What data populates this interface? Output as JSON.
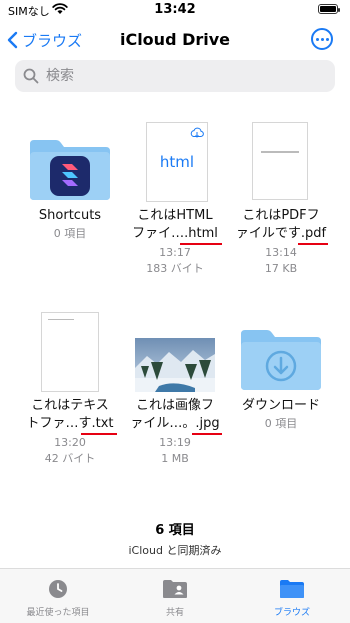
{
  "status_bar": {
    "carrier": "SIMなし",
    "time": "13:42"
  },
  "nav": {
    "back_label": "ブラウズ",
    "title": "iCloud Drive"
  },
  "search": {
    "placeholder": "検索"
  },
  "items": [
    {
      "name_line1": "Shortcuts",
      "name_line2": "",
      "meta1": "0 項目",
      "meta2": "",
      "icon": "shortcuts-folder-icon"
    },
    {
      "name_line1": "これはHTML",
      "name_line2": "ファイ….html",
      "meta1": "13:17",
      "meta2": "183 バイト",
      "thumb_text": "html",
      "icon": "html-file-icon"
    },
    {
      "name_line1": "これはPDFフ",
      "name_line2": "ァイルです.pdf",
      "meta1": "13:14",
      "meta2": "17 KB",
      "icon": "pdf-file-icon"
    },
    {
      "name_line1": "これはテキス",
      "name_line2": "トファ…す.txt",
      "meta1": "13:20",
      "meta2": "42 バイト",
      "icon": "txt-file-icon"
    },
    {
      "name_line1": "これは画像フ",
      "name_line2": "ァイル…。.jpg",
      "meta1": "13:19",
      "meta2": "1 MB",
      "icon": "jpg-file-icon"
    },
    {
      "name_line1": "ダウンロード",
      "name_line2": "",
      "meta1": "0 項目",
      "meta2": "",
      "icon": "downloads-folder-icon"
    }
  ],
  "footer": {
    "count": "6 項目",
    "sync": "iCloud と同期済み"
  },
  "tabs": [
    {
      "label": "最近使った項目",
      "icon": "clock-icon"
    },
    {
      "label": "共有",
      "icon": "shared-folder-icon"
    },
    {
      "label": "ブラウズ",
      "icon": "folder-icon",
      "active": true
    }
  ],
  "colors": {
    "accent": "#1a7af4",
    "folder": "#87c4f2",
    "annotation": "#e60012"
  }
}
